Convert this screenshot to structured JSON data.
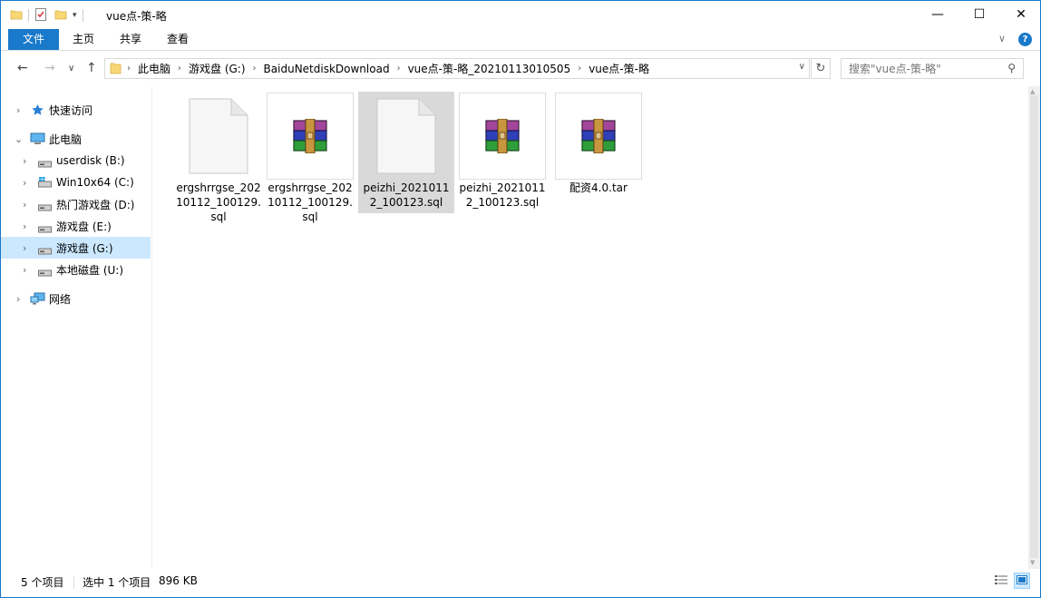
{
  "window": {
    "title": "vue点-策-略",
    "minimize": "—",
    "maximize": "☐",
    "close": "✕"
  },
  "ribbon": {
    "tabs": [
      {
        "label": "文件",
        "active": true
      },
      {
        "label": "主页"
      },
      {
        "label": "共享"
      },
      {
        "label": "查看"
      }
    ],
    "accent_color": "#1979ca"
  },
  "navigation": {
    "back": "←",
    "forward": "→",
    "recent": "∨",
    "up": "↑",
    "breadcrumbs": [
      "此电脑",
      "游戏盘 (G:)",
      "BaiduNetdiskDownload",
      "vue点-策-略_20210113010505",
      "vue点-策-略"
    ],
    "search_placeholder": "搜索\"vue点-策-略\""
  },
  "sidebar": {
    "items": [
      {
        "label": "快速访问",
        "icon": "star-icon",
        "level": 0,
        "expander": "›"
      },
      {
        "label": "此电脑",
        "icon": "computer-icon",
        "level": 0,
        "expander": "⌄",
        "expanded": true
      },
      {
        "label": "userdisk (B:)",
        "icon": "drive-icon",
        "level": 1,
        "expander": "›"
      },
      {
        "label": "Win10x64 (C:)",
        "icon": "windows-drive-icon",
        "level": 1,
        "expander": "›"
      },
      {
        "label": "热门游戏盘 (D:)",
        "icon": "drive-icon",
        "level": 1,
        "expander": "›"
      },
      {
        "label": "游戏盘 (E:)",
        "icon": "drive-icon",
        "level": 1,
        "expander": "›"
      },
      {
        "label": "游戏盘 (G:)",
        "icon": "drive-icon",
        "level": 1,
        "expander": "›",
        "selected": true
      },
      {
        "label": "本地磁盘 (U:)",
        "icon": "drive-icon",
        "level": 1,
        "expander": "›"
      },
      {
        "label": "网络",
        "icon": "network-icon",
        "level": 0,
        "expander": "›"
      }
    ]
  },
  "files": [
    {
      "name": "ergshrrgse_20210112_100129.sql",
      "icon": "blank-file-icon",
      "selected": false
    },
    {
      "name": "ergshrrgse_20210112_100129.sql",
      "icon": "winrar-archive-icon",
      "selected": false
    },
    {
      "name": "peizhi_20210112_100123.sql",
      "icon": "blank-file-icon",
      "selected": true
    },
    {
      "name": "peizhi_20210112_100123.sql",
      "icon": "winrar-archive-icon",
      "selected": false
    },
    {
      "name": "配资4.0.tar",
      "icon": "winrar-archive-icon",
      "selected": false
    }
  ],
  "status": {
    "item_count": "5 个项目",
    "selection": "选中 1 个项目",
    "size": "896 KB"
  }
}
